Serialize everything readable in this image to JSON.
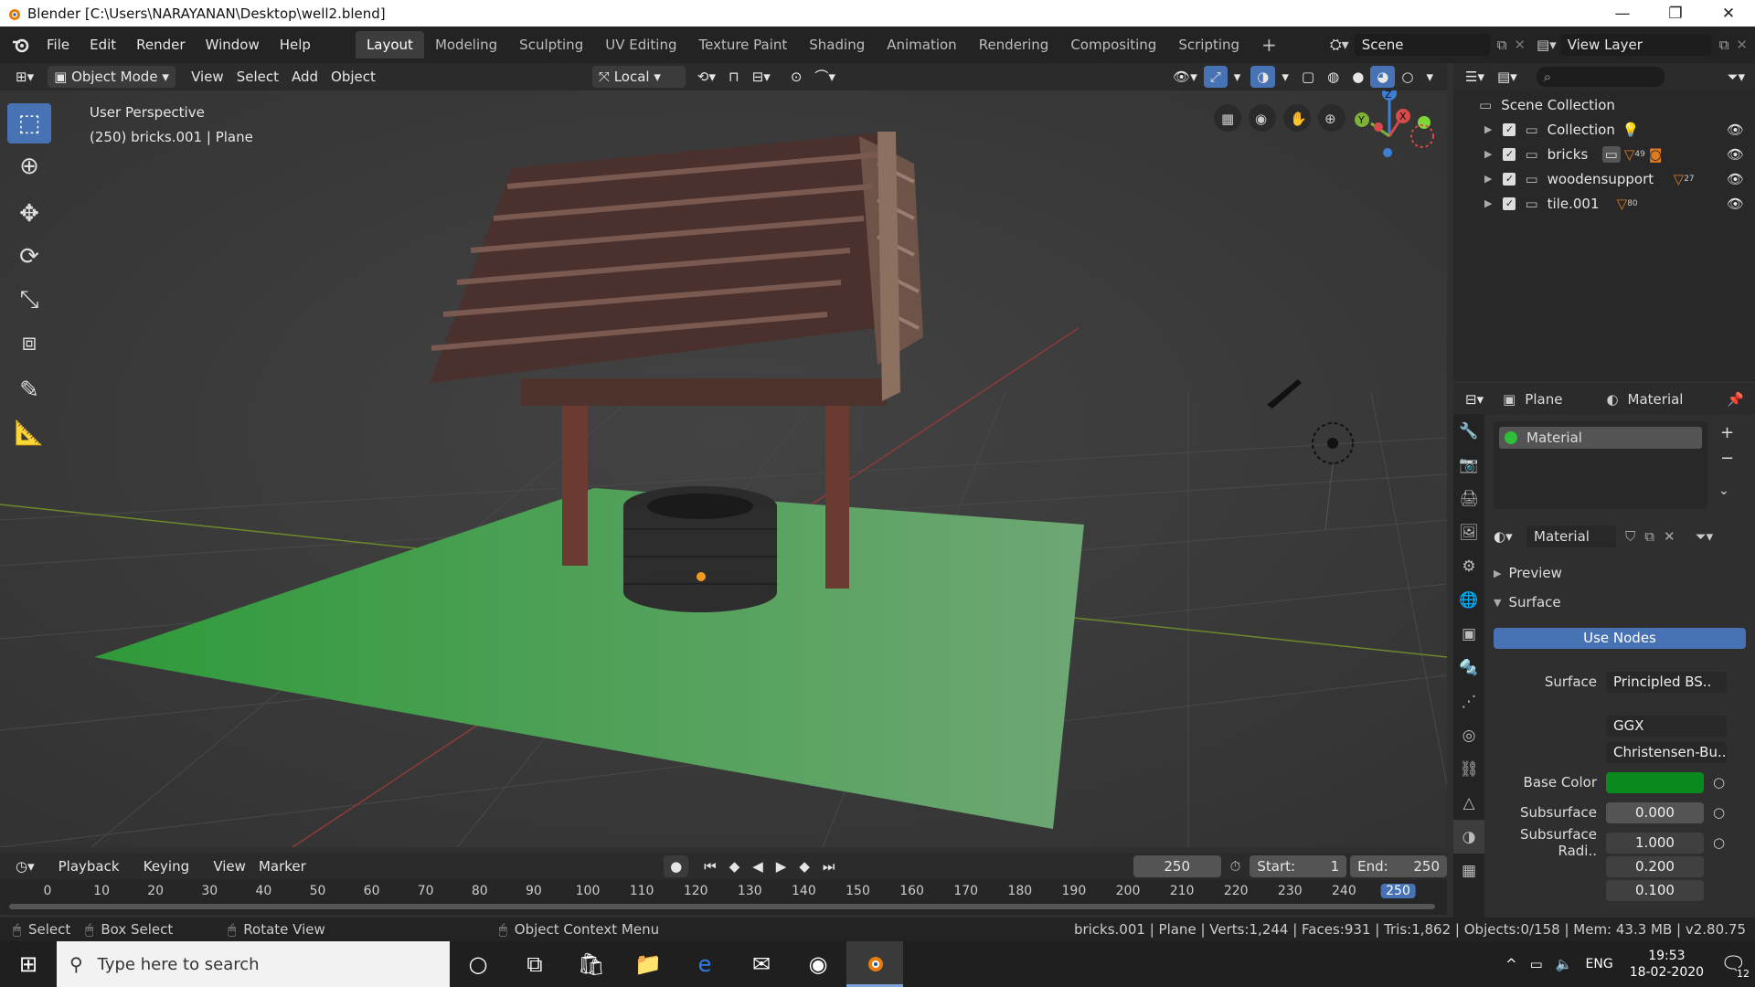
{
  "window": {
    "title": "Blender [C:\\Users\\NARAYANAN\\Desktop\\well2.blend]",
    "controls": [
      "—",
      "❐",
      "✕"
    ]
  },
  "menu": [
    "File",
    "Edit",
    "Render",
    "Window",
    "Help"
  ],
  "workspaces": [
    "Layout",
    "Modeling",
    "Sculpting",
    "UV Editing",
    "Texture Paint",
    "Shading",
    "Animation",
    "Rendering",
    "Compositing",
    "Scripting"
  ],
  "active_workspace": "Layout",
  "scene": "Scene",
  "view_layer": "View Layer",
  "viewport_header": {
    "mode": "Object Mode",
    "menus": [
      "View",
      "Select",
      "Add",
      "Object"
    ],
    "transform_orientation": "Local"
  },
  "viewport": {
    "perspective": "User Perspective",
    "object_info": "(250) bricks.001 | Plane",
    "axis_labels": {
      "x": "X",
      "y": "Y",
      "z": "Z"
    }
  },
  "outliner": {
    "root": "Scene Collection",
    "items": [
      {
        "name": "Collection",
        "badge": ""
      },
      {
        "name": "bricks",
        "badge": "49"
      },
      {
        "name": "woodensupport",
        "badge": "27"
      },
      {
        "name": "tile.001",
        "badge": "80"
      }
    ]
  },
  "properties": {
    "object": "Plane",
    "data_tab": "Material",
    "slot_name": "Material",
    "material_name": "Material",
    "sections": {
      "preview": "Preview",
      "surface": "Surface"
    },
    "use_nodes": "Use Nodes",
    "surface_label": "Surface",
    "surface_value": "Principled BS..",
    "distribution": "GGX",
    "subsurface_method": "Christensen-Bu..",
    "base_color_label": "Base Color",
    "base_color": "#0a8a1e",
    "subsurface_label": "Subsurface",
    "subsurface_value": "0.000",
    "subsurface_radius_label": "Subsurface Radi..",
    "subsurface_radius": [
      "1.000",
      "0.200",
      "0.100"
    ]
  },
  "timeline": {
    "menus": [
      "Playback",
      "Keying",
      "View",
      "Marker"
    ],
    "current_frame": "250",
    "start_label": "Start:",
    "start": "1",
    "end_label": "End:",
    "end": "250",
    "ticks": [
      "0",
      "10",
      "20",
      "30",
      "40",
      "50",
      "60",
      "70",
      "80",
      "90",
      "100",
      "110",
      "120",
      "130",
      "140",
      "150",
      "160",
      "170",
      "180",
      "190",
      "200",
      "210",
      "220",
      "230",
      "240",
      "250"
    ]
  },
  "status": {
    "select": "Select",
    "box_select": "Box Select",
    "rotate_view": "Rotate View",
    "context_menu": "Object Context Menu",
    "stats": "bricks.001 | Plane | Verts:1,244 | Faces:931 | Tris:1,862 | Objects:0/158 | Mem: 43.3 MB | v2.80.75"
  },
  "taskbar": {
    "search_placeholder": "Type here to search",
    "lang": "ENG",
    "time": "19:53",
    "date": "18-02-2020",
    "notif_count": "12"
  }
}
